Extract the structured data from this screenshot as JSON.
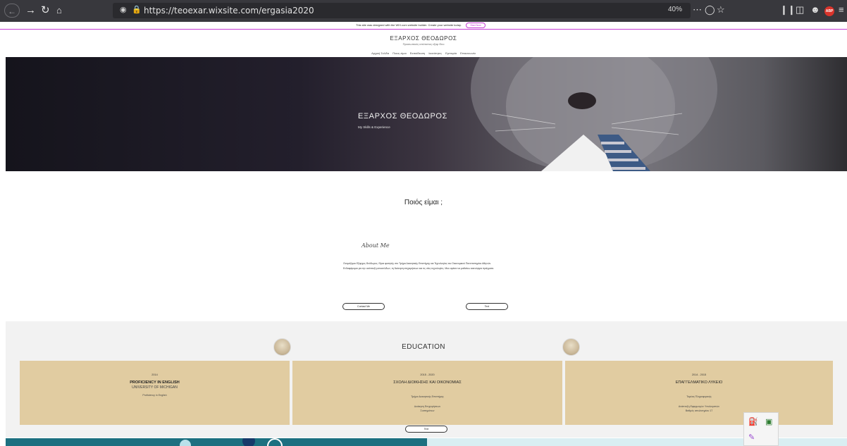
{
  "browser": {
    "url": "https://teoexar.wixsite.com/ergasia2020",
    "zoom": "40%",
    "adblock_label": "ABP"
  },
  "wix_banner": {
    "text": "This site was designed with the WIX.com website builder. Create your website today.",
    "button": "Start Now"
  },
  "site": {
    "title": "ΕΞΑΡΧΟΣ ΘΕΟΔΩΡΟΣ",
    "subtitle": "Προσωπικός ιστότοπος εξαρ Θεο",
    "nav": [
      "Αρχική Σελίδα",
      "Ποιος είμαι",
      "Εκπαίδευση",
      "Ικανότητες",
      "Εμπειρία",
      "Επικοινωνία"
    ]
  },
  "hero": {
    "name": "ΕΞΑΡΧΟΣ ΘΕΟΔΩΡΟΣ",
    "tagline": "My Skills & Experience"
  },
  "about": {
    "section_title": "Ποιός είμαι ;",
    "script_heading": "About Me",
    "paragraph": "Ονομάζομαι Εξαρχος Θεόδωρος. Είμαι φοιτητής στο Τμήμα Διοικητικής Επιστήμης και Τεχνολογίας του Οικονομικού Πανεπιστημίου Αθηνών. Ενδιαφέρομαι για την ανάπτυξη ιστοσελίδων, τη διοίκηση επιχειρήσεων και τις νέες τεχνολογίες. Μου αρέσει να μαθαίνω καινούργια πράγματα.",
    "button_contact": "Contact Me",
    "button_cv": "Text"
  },
  "education": {
    "title": "EDUCATION",
    "button": "Text",
    "cards": [
      {
        "years": "2014",
        "heading": "PROFICIENCY IN ENGLISH",
        "subheading": "UNIVERSITY OF MICHIGAN",
        "details": [
          "Proficiency in English"
        ]
      },
      {
        "years": "2015 - 2020",
        "heading": "ΣΧΟΛΗ ΔΙΟΙΚΗΣΗΣ ΚΑΙ ΟΙΚΟΝΟΜΙΑΣ",
        "subheading": "",
        "details": [
          "Τμήμα Διοικητικής Επιστήμης",
          "Διοίκηση Επιχειρήσεων",
          "Συστημάτων"
        ]
      },
      {
        "years": "2014 - 2015",
        "heading": "ΕΠΑΓΓΕΛΜΑΤΙΚΟ ΛΥΚΕΙΟ",
        "subheading": "",
        "details": [
          "Τομέας Πληροφορικής",
          "Ανάπτυξη Εφαρμογών Υπολογιστών",
          "Βαθμός απολυτηρίου 17"
        ]
      }
    ]
  }
}
